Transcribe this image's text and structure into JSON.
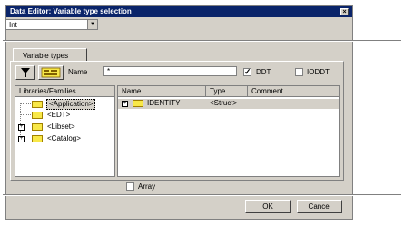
{
  "window": {
    "title": "Data Editor: Variable type selection",
    "close_label": "×"
  },
  "type_combo": {
    "value": "Int"
  },
  "tab": {
    "label": "Variable types"
  },
  "toolbar": {
    "filter_icon": "filter-icon",
    "toggle_icon": "toggle-filter-icon",
    "name_label": "Name",
    "name_value": "*"
  },
  "filters": {
    "ddt": {
      "label": "DDT",
      "checked": true
    },
    "ioddt": {
      "label": "IODDT",
      "checked": false
    },
    "array": {
      "label": "Array",
      "checked": false
    }
  },
  "libraries": {
    "header": "Libraries/Families",
    "items": [
      {
        "label": "<Application>",
        "selected": true,
        "expandable": false
      },
      {
        "label": "<EDT>",
        "selected": false,
        "expandable": false
      },
      {
        "label": "<Libset>",
        "selected": false,
        "expandable": true
      },
      {
        "label": "<Catalog>",
        "selected": false,
        "expandable": true
      }
    ]
  },
  "types_table": {
    "columns": [
      "Name",
      "Type",
      "Comment"
    ],
    "rows": [
      {
        "name": "IDENTITY",
        "type": "<Struct>",
        "comment": ""
      }
    ]
  },
  "buttons": {
    "ok": "OK",
    "cancel": "Cancel"
  },
  "colors": {
    "titlebar": "#0a246a",
    "dialog_bg": "#d4d0c8",
    "folder": "#f8e848",
    "selection": "#d4d0c8"
  }
}
